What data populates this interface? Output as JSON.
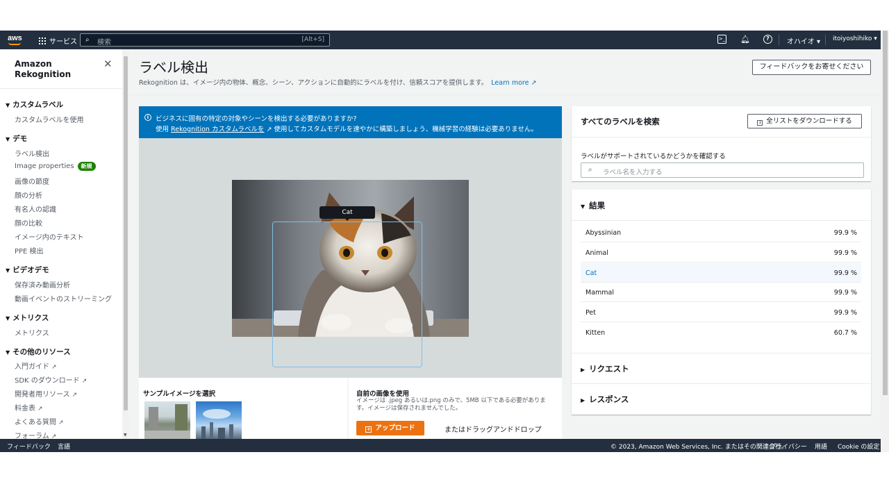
{
  "topnav": {
    "logo": "aws",
    "services_label": "サービス",
    "search_placeholder": "検索",
    "search_shortcut": "[Alt+S]",
    "region": "オハイオ ▾",
    "user": "itoiyoshihiko ▾",
    "icons": [
      "cloudshell-icon",
      "bell-icon",
      "help-icon"
    ]
  },
  "sidenav": {
    "title": "Amazon Rekognition",
    "sections": [
      {
        "label": "カスタムラベル",
        "items": [
          {
            "label": "カスタムラベルを使用"
          }
        ]
      },
      {
        "label": "デモ",
        "items": [
          {
            "label": "ラベル検出"
          },
          {
            "label": "Image properties",
            "badge": "新規"
          },
          {
            "label": "画像の節度"
          },
          {
            "label": "顔の分析"
          },
          {
            "label": "有名人の認識"
          },
          {
            "label": "顔の比較"
          },
          {
            "label": "イメージ内のテキスト"
          },
          {
            "label": "PPE 検出"
          }
        ]
      },
      {
        "label": "ビデオデモ",
        "items": [
          {
            "label": "保存済み動画分析"
          },
          {
            "label": "動画イベントのストリーミング"
          }
        ]
      },
      {
        "label": "メトリクス",
        "items": [
          {
            "label": "メトリクス"
          }
        ]
      },
      {
        "label": "その他のリソース",
        "items": [
          {
            "label": "入門ガイド",
            "external": true
          },
          {
            "label": "SDK のダウンロード",
            "external": true
          },
          {
            "label": "開発者用リソース",
            "external": true
          },
          {
            "label": "料金表",
            "external": true
          },
          {
            "label": "よくある質問",
            "external": true
          },
          {
            "label": "フォーラム",
            "external": true
          }
        ]
      }
    ]
  },
  "header": {
    "title": "ラベル検出",
    "description": "Rekognition は、イメージ内の物体、概念、シーン、アクションに自動的にラベルを付け、信頼スコアを提供します。",
    "learn_more": "Learn more",
    "feedback_button": "フィードバックをお寄せください"
  },
  "banner": {
    "line1": "ビジネスに固有の特定の対象やシーンを検出する必要がありますか?",
    "line2_prefix": "使用",
    "line2_link": "Rekognition カスタムラベルを",
    "line2_suffix": "使用してカスタムモデルを速やかに構築しましょう、機械学習の経験は必要ありません。"
  },
  "image": {
    "detection_label": "Cat"
  },
  "sample": {
    "title": "サンプルイメージを選択"
  },
  "own_image": {
    "title": "自前の画像を使用",
    "description": "イメージは .jpeg あるいは.png のみで、5MB 以下である必要があります。イメージは保存されませんでした。",
    "upload_button": "アップロード",
    "drop_text": "またはドラッグアンドドロップ"
  },
  "label_search": {
    "title": "すべてのラベルを検索",
    "download_button": "全リストをダウンロードする",
    "field_label": "ラベルがサポートされているかどうかを確認する",
    "placeholder": "ラベル名を入力する"
  },
  "results": {
    "title": "結果",
    "rows": [
      {
        "name": "Abyssinian",
        "score": "99.9 %"
      },
      {
        "name": "Animal",
        "score": "99.9 %"
      },
      {
        "name": "Cat",
        "score": "99.9 %"
      },
      {
        "name": "Mammal",
        "score": "99.9 %"
      },
      {
        "name": "Pet",
        "score": "99.9 %"
      },
      {
        "name": "Kitten",
        "score": "60.7 %"
      }
    ],
    "request_title": "リクエスト",
    "response_title": "レスポンス"
  },
  "footer": {
    "feedback": "フィードバック",
    "language": "言語",
    "copyright": "© 2023, Amazon Web Services, Inc. またはその関連会社。",
    "privacy": "プライバシー",
    "terms": "用語",
    "cookie": "Cookie の設定"
  },
  "colors": {
    "nav": "#232f3e",
    "accent": "#ec7211",
    "link": "#0073bb",
    "banner": "#0073bb",
    "badge": "#1d8102"
  }
}
